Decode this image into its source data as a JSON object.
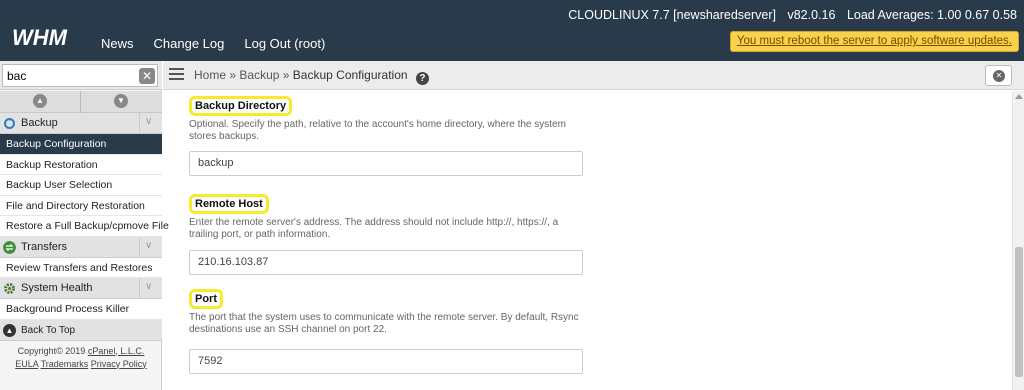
{
  "header": {
    "logo_text": "WHM",
    "nav": [
      "News",
      "Change Log",
      "Log Out (root)"
    ],
    "os": "CLOUDLINUX 7.7 [newsharedserver]",
    "version": "v82.0.16",
    "load_averages": "Load Averages: 1.00 0.67 0.58",
    "alert": "You must reboot the server to apply software updates."
  },
  "sidebar": {
    "search_value": "bac",
    "categories": [
      {
        "label": "Backup",
        "icon": "backup-icon",
        "items": [
          "Backup Configuration",
          "Backup Restoration",
          "Backup User Selection",
          "File and Directory Restoration",
          "Restore a Full Backup/cpmove File"
        ]
      },
      {
        "label": "Transfers",
        "icon": "transfers-icon",
        "items": [
          "Review Transfers and Restores"
        ]
      },
      {
        "label": "System Health",
        "icon": "gear-icon",
        "items": [
          "Background Process Killer"
        ]
      }
    ],
    "back_to_top": "Back To Top",
    "copyright": "Copyright© 2019",
    "company": "cPanel, L.L.C.",
    "links": [
      "EULA",
      "Trademarks",
      "Privacy Policy"
    ]
  },
  "breadcrumb": {
    "items": [
      "Home",
      "Backup",
      "Backup Configuration"
    ],
    "separator": "»"
  },
  "form": {
    "directory": {
      "label": "Backup Directory",
      "help": "Optional. Specify the path, relative to the account's home directory, where the system stores backups.",
      "value": "backup"
    },
    "host": {
      "label": "Remote Host",
      "help": "Enter the remote server's address. The address should not include http://, https://, a trailing port, or path information.",
      "value": "210.16.103.87"
    },
    "port": {
      "label": "Port",
      "help": "The port that the system uses to communicate with the remote server. By default, Rsync destinations use an SSH channel on port 22.",
      "value": "7592"
    }
  },
  "colors": {
    "header_bg": "#293a4a",
    "active_item_bg": "#293a4a",
    "alert_bg": "#f7d24a",
    "highlight": "#f7ea2a"
  }
}
